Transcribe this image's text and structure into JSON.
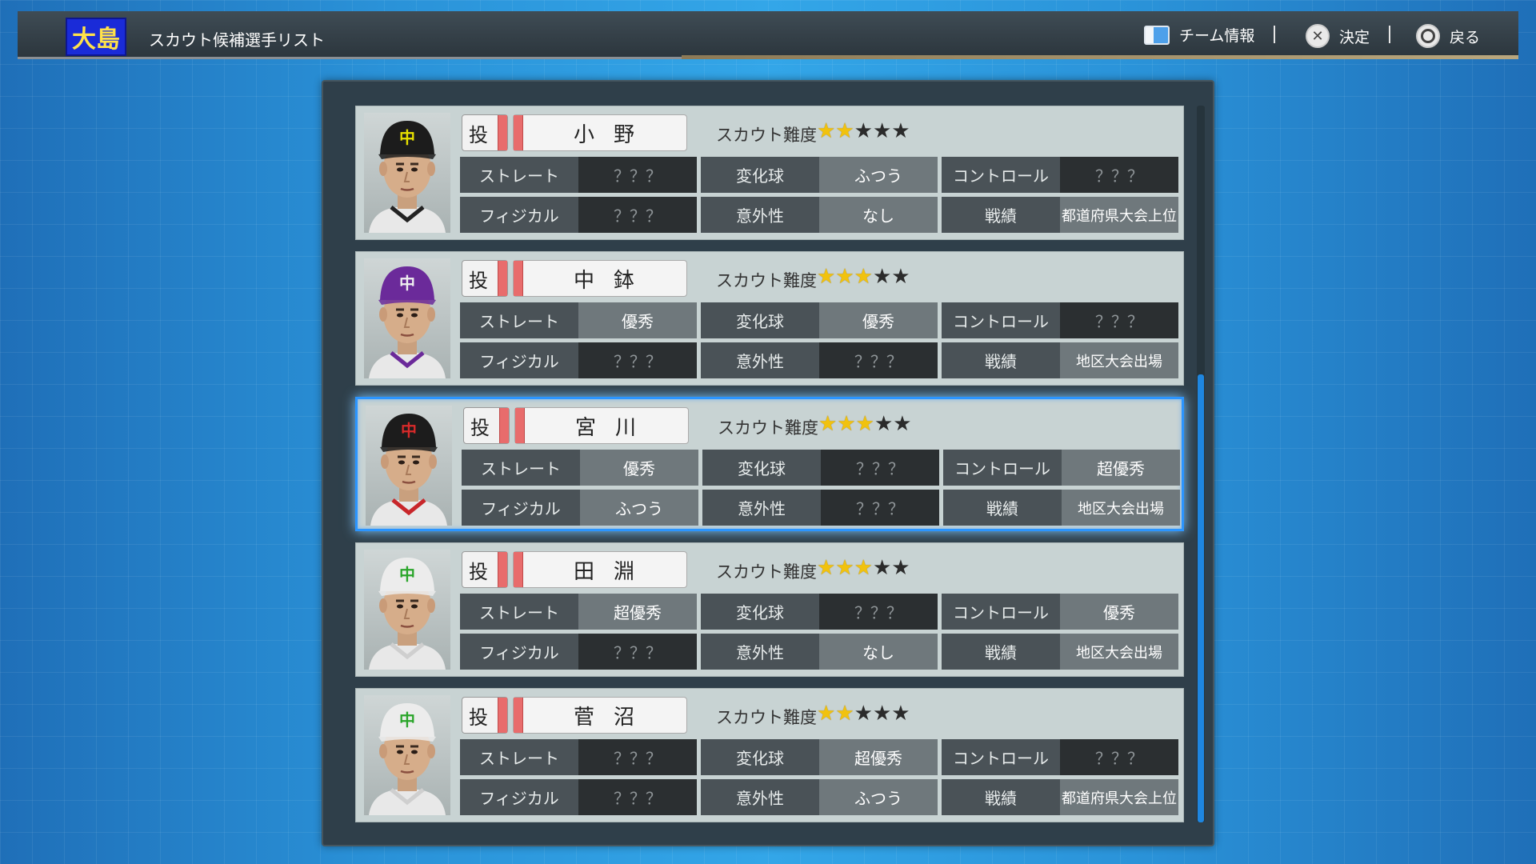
{
  "header": {
    "logo_text": "大島",
    "title": "スカウト候補選手リスト",
    "hints": [
      {
        "icon": "square-button-icon",
        "label": "チーム情報"
      },
      {
        "icon": "cross-button-icon",
        "label": "決定"
      },
      {
        "icon": "circle-button-icon",
        "label": "戻る"
      }
    ]
  },
  "labels": {
    "difficulty": "スカウト難度",
    "straight": "ストレート",
    "breaking": "変化球",
    "control": "コントロール",
    "physical": "フィジカル",
    "surprise": "意外性",
    "record": "戦績"
  },
  "players": [
    {
      "position": "投",
      "name": "小野",
      "difficulty": 2,
      "max_difficulty": 5,
      "cap_color": "#1c1c1c",
      "cap_letter_color": "#e9e200",
      "jersey_trim": "#222222",
      "straight": "？？？",
      "breaking": "ふつう",
      "control": "？？？",
      "physical": "？？？",
      "surprise": "なし",
      "record": "都道府県大会上位",
      "selected": false
    },
    {
      "position": "投",
      "name": "中鉢",
      "difficulty": 3,
      "max_difficulty": 5,
      "cap_color": "#6b2a9a",
      "cap_letter_color": "#f0f0f0",
      "jersey_trim": "#6b2a9a",
      "straight": "優秀",
      "breaking": "優秀",
      "control": "？？？",
      "physical": "？？？",
      "surprise": "？？？",
      "record": "地区大会出場",
      "selected": false
    },
    {
      "position": "投",
      "name": "宮川",
      "difficulty": 3,
      "max_difficulty": 5,
      "cap_color": "#1c1c1c",
      "cap_letter_color": "#d92a2a",
      "jersey_trim": "#c8262a",
      "straight": "優秀",
      "breaking": "？？？",
      "control": "超優秀",
      "physical": "ふつう",
      "surprise": "？？？",
      "record": "地区大会出場",
      "selected": true
    },
    {
      "position": "投",
      "name": "田淵",
      "difficulty": 3,
      "max_difficulty": 5,
      "cap_color": "#ececec",
      "cap_letter_color": "#2aa52a",
      "jersey_trim": "#cfcfcf",
      "straight": "超優秀",
      "breaking": "？？？",
      "control": "優秀",
      "physical": "？？？",
      "surprise": "なし",
      "record": "地区大会出場",
      "selected": false
    },
    {
      "position": "投",
      "name": "菅沼",
      "difficulty": 2,
      "max_difficulty": 5,
      "cap_color": "#ececec",
      "cap_letter_color": "#2aa52a",
      "jersey_trim": "#cfcfcf",
      "straight": "？？？",
      "breaking": "超優秀",
      "control": "？？？",
      "physical": "？？？",
      "surprise": "ふつう",
      "record": "都道府県大会上位",
      "selected": false
    }
  ],
  "colors": {
    "selection": "#2b95ff",
    "star_on": "#f1c20e",
    "star_off": "#2b2b2b",
    "scroll_thumb": "#1e86e0"
  }
}
